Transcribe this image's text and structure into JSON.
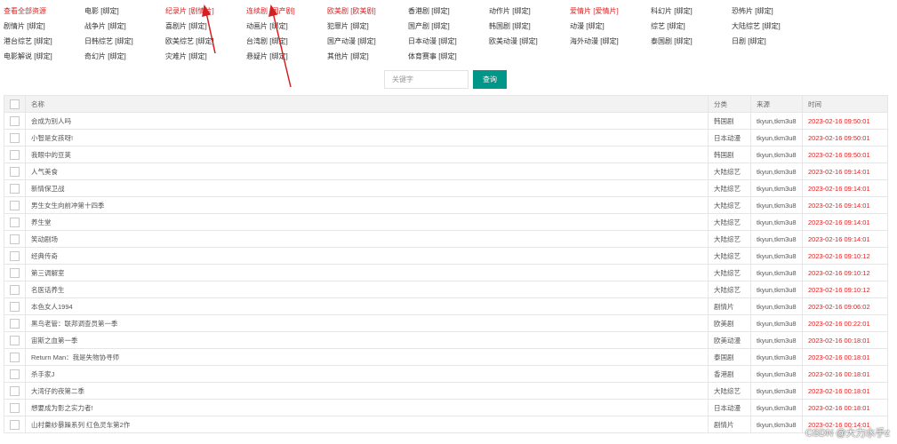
{
  "categories": [
    {
      "name": "查看全部资源",
      "tag": "",
      "all": true,
      "hot": false,
      "col": 0,
      "row": 0
    },
    {
      "name": "电影",
      "tag": "[绑定]",
      "hot": false,
      "col": 1,
      "row": 0
    },
    {
      "name": "纪录片",
      "tag": "[剧情片]",
      "hot": true,
      "col": 2,
      "row": 0
    },
    {
      "name": "连续剧",
      "tag": "[国产剧]",
      "hot": true,
      "col": 3,
      "row": 0
    },
    {
      "name": "欧美剧",
      "tag": "[欧美剧]",
      "hot": true,
      "col": 4,
      "row": 0
    },
    {
      "name": "香港剧",
      "tag": "[绑定]",
      "hot": false,
      "col": 5,
      "row": 0
    },
    {
      "name": "动作片",
      "tag": "[绑定]",
      "hot": false,
      "col": 6,
      "row": 0
    },
    {
      "name": "爱情片",
      "tag": "[爱情片]",
      "hot": true,
      "col": 7,
      "row": 0
    },
    {
      "name": "科幻片",
      "tag": "[绑定]",
      "hot": false,
      "col": 8,
      "row": 0
    },
    {
      "name": "恐怖片",
      "tag": "[绑定]",
      "hot": false,
      "col": 9,
      "row": 0
    },
    {
      "name": "剧情片",
      "tag": "[绑定]",
      "hot": false,
      "col": 0,
      "row": 1
    },
    {
      "name": "战争片",
      "tag": "[绑定]",
      "hot": false,
      "col": 1,
      "row": 1
    },
    {
      "name": "喜剧片",
      "tag": "[绑定]",
      "hot": false,
      "col": 2,
      "row": 1
    },
    {
      "name": "动画片",
      "tag": "[绑定]",
      "hot": false,
      "col": 3,
      "row": 1
    },
    {
      "name": "犯罪片",
      "tag": "[绑定]",
      "hot": false,
      "col": 4,
      "row": 1
    },
    {
      "name": "国产剧",
      "tag": "[绑定]",
      "hot": false,
      "col": 5,
      "row": 1
    },
    {
      "name": "韩国剧",
      "tag": "[绑定]",
      "hot": false,
      "col": 6,
      "row": 1
    },
    {
      "name": "动漫",
      "tag": "[绑定]",
      "hot": false,
      "col": 7,
      "row": 1
    },
    {
      "name": "综艺",
      "tag": "[绑定]",
      "hot": false,
      "col": 8,
      "row": 1
    },
    {
      "name": "大陆综艺",
      "tag": "[绑定]",
      "hot": false,
      "col": 9,
      "row": 1
    },
    {
      "name": "港台综艺",
      "tag": "[绑定]",
      "hot": false,
      "col": 0,
      "row": 2
    },
    {
      "name": "日韩综艺",
      "tag": "[绑定]",
      "hot": false,
      "col": 1,
      "row": 2
    },
    {
      "name": "欧美综艺",
      "tag": "[绑定]",
      "hot": false,
      "col": 2,
      "row": 2
    },
    {
      "name": "台湾剧",
      "tag": "[绑定]",
      "hot": false,
      "col": 3,
      "row": 2
    },
    {
      "name": "国产动漫",
      "tag": "[绑定]",
      "hot": false,
      "col": 4,
      "row": 2
    },
    {
      "name": "日本动漫",
      "tag": "[绑定]",
      "hot": false,
      "col": 5,
      "row": 2
    },
    {
      "name": "欧美动漫",
      "tag": "[绑定]",
      "hot": false,
      "col": 6,
      "row": 2
    },
    {
      "name": "海外动漫",
      "tag": "[绑定]",
      "hot": false,
      "col": 7,
      "row": 2
    },
    {
      "name": "泰国剧",
      "tag": "[绑定]",
      "hot": false,
      "col": 8,
      "row": 2
    },
    {
      "name": "日剧",
      "tag": "[绑定]",
      "hot": false,
      "col": 9,
      "row": 2
    },
    {
      "name": "电影解说",
      "tag": "[绑定]",
      "hot": false,
      "col": 0,
      "row": 3
    },
    {
      "name": "奇幻片",
      "tag": "[绑定]",
      "hot": false,
      "col": 1,
      "row": 3
    },
    {
      "name": "灾难片",
      "tag": "[绑定]",
      "hot": false,
      "col": 2,
      "row": 3
    },
    {
      "name": "悬疑片",
      "tag": "[绑定]",
      "hot": false,
      "col": 3,
      "row": 3
    },
    {
      "name": "其他片",
      "tag": "[绑定]",
      "hot": false,
      "col": 4,
      "row": 3
    },
    {
      "name": "体育赛事",
      "tag": "[绑定]",
      "hot": false,
      "col": 5,
      "row": 3
    }
  ],
  "search": {
    "placeholder": "关键字",
    "button": "查询"
  },
  "table": {
    "headers": {
      "name": "名称",
      "category": "分类",
      "source": "来源",
      "time": "时间"
    },
    "rows": [
      {
        "name": "会成为别人吗",
        "category": "韩国剧",
        "source": "tkyun,tkm3u8",
        "time": "2023-02-16 09:50:01"
      },
      {
        "name": "小智是女孩呀!",
        "category": "日本动漫",
        "source": "tkyun,tkm3u8",
        "time": "2023-02-16 09:50:01"
      },
      {
        "name": "我眼中的豆荚",
        "category": "韩国剧",
        "source": "tkyun,tkm3u8",
        "time": "2023-02-16 09:50:01"
      },
      {
        "name": "人气美食",
        "category": "大陆综艺",
        "source": "tkyun,tkm3u8",
        "time": "2023-02-16 09:14:01"
      },
      {
        "name": "新情保卫战",
        "category": "大陆综艺",
        "source": "tkyun,tkm3u8",
        "time": "2023-02-16 09:14:01"
      },
      {
        "name": "男生女生向前冲第十四季",
        "category": "大陆综艺",
        "source": "tkyun,tkm3u8",
        "time": "2023-02-16 09:14:01"
      },
      {
        "name": "养生堂",
        "category": "大陆综艺",
        "source": "tkyun,tkm3u8",
        "time": "2023-02-16 09:14:01"
      },
      {
        "name": "笑动剧场",
        "category": "大陆综艺",
        "source": "tkyun,tkm3u8",
        "time": "2023-02-16 09:14:01"
      },
      {
        "name": "经典传奇",
        "category": "大陆综艺",
        "source": "tkyun,tkm3u8",
        "time": "2023-02-16 09:10:12"
      },
      {
        "name": "第三调解室",
        "category": "大陆综艺",
        "source": "tkyun,tkm3u8",
        "time": "2023-02-16 09:10:12"
      },
      {
        "name": "名医话养生",
        "category": "大陆综艺",
        "source": "tkyun,tkm3u8",
        "time": "2023-02-16 09:10:12"
      },
      {
        "name": "本色女人1994",
        "category": "剧情片",
        "source": "tkyun,tkm3u8",
        "time": "2023-02-16 09:06:02"
      },
      {
        "name": "黑鸟老管：联邦调查员第一季",
        "category": "欧美剧",
        "source": "tkyun,tkm3u8",
        "time": "2023-02-16 00:22:01"
      },
      {
        "name": "宙斯之血第一季",
        "category": "欧美动漫",
        "source": "tkyun,tkm3u8",
        "time": "2023-02-16 00:18:01"
      },
      {
        "name": "Return Man：我是失物协寻师",
        "category": "泰国剧",
        "source": "tkyun,tkm3u8",
        "time": "2023-02-16 00:18:01"
      },
      {
        "name": "杀手家J",
        "category": "香港剧",
        "source": "tkyun,tkm3u8",
        "time": "2023-02-16 00:18:01"
      },
      {
        "name": "大湾仔的夜第二季",
        "category": "大陆综艺",
        "source": "tkyun,tkm3u8",
        "time": "2023-02-16 00:18:01"
      },
      {
        "name": "想要成为影之实力者!",
        "category": "日本动漫",
        "source": "tkyun,tkm3u8",
        "time": "2023-02-16 00:18:01"
      },
      {
        "name": "山村羹纱暴躁系列 红色灵车第2作",
        "category": "剧情片",
        "source": "tkyun,tkm3u8",
        "time": "2023-02-16 00:14:01"
      }
    ]
  },
  "watermark": "CSDN @大力水手z",
  "colors": {
    "accent": "#009688",
    "highlight": "#e02020"
  }
}
